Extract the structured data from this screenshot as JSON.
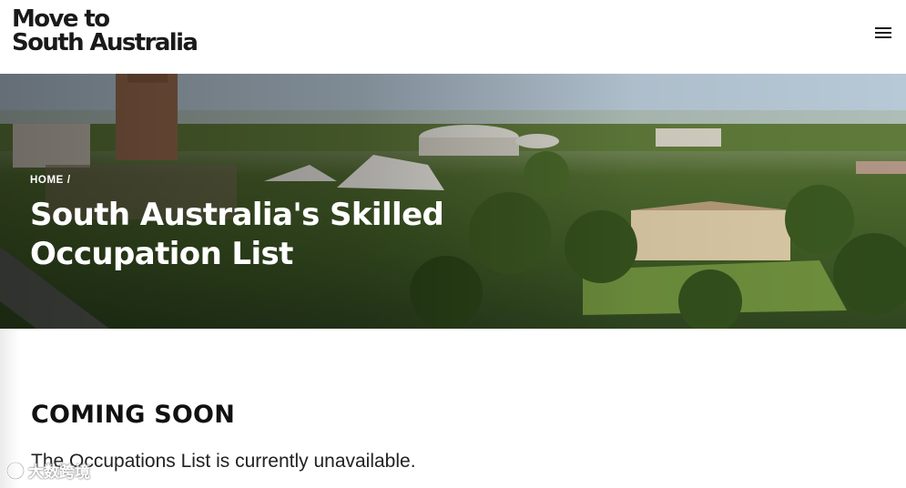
{
  "header": {
    "logo_line1": "Move to",
    "logo_line2": "South Australia",
    "menu_icon": "hamburger-menu-icon"
  },
  "hero": {
    "breadcrumb": {
      "home": "HOME",
      "separator": "/"
    },
    "title": "South Australia's Skilled Occupation List"
  },
  "main": {
    "heading": "COMING SOON",
    "message": "The Occupations List is currently unavailable."
  },
  "watermark": {
    "text": "大数跨境"
  },
  "colors": {
    "text": "#111111",
    "background": "#ffffff",
    "hero_text": "#ffffff"
  }
}
